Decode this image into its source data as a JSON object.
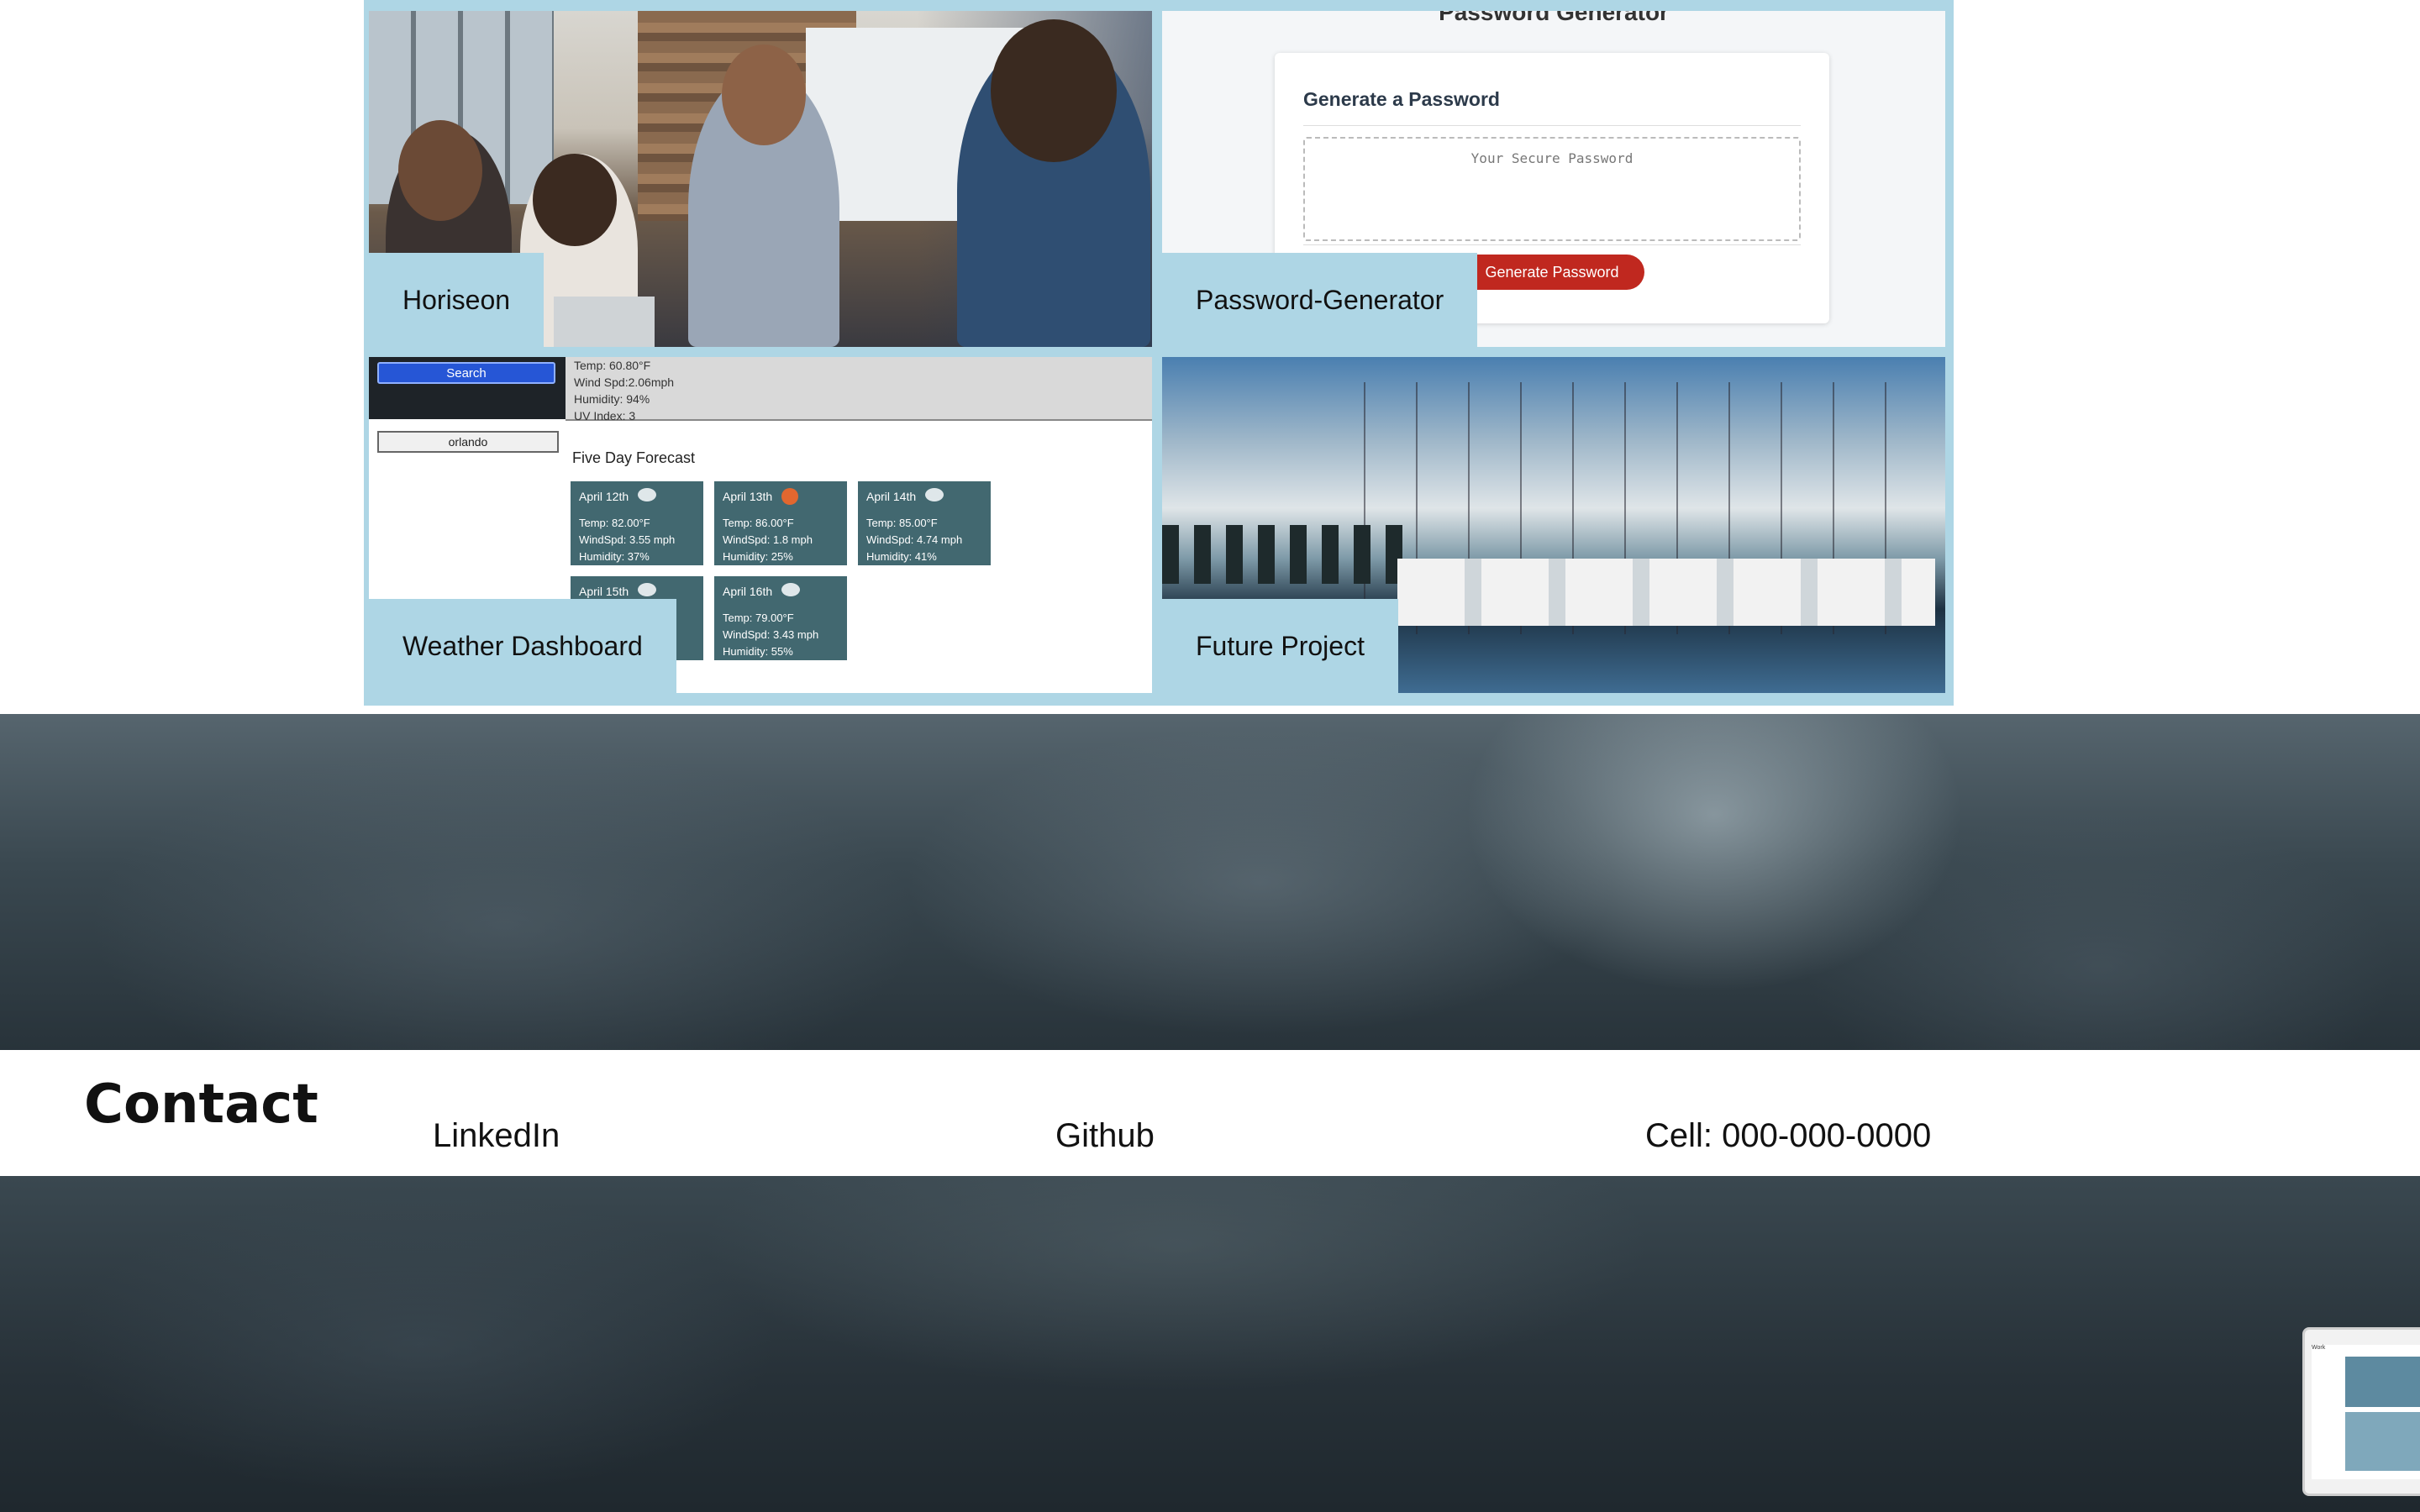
{
  "projects": [
    {
      "label": "Horiseon",
      "image": "office-team-photo"
    },
    {
      "label": "Password-Generator",
      "image": "password-generator-screenshot"
    },
    {
      "label": "Weather Dashboard",
      "image": "weather-dashboard-screenshot"
    },
    {
      "label": "Future Project",
      "image": "marina-photo"
    }
  ],
  "password_app": {
    "title": "Password Generator",
    "card_heading": "Generate a Password",
    "placeholder": "Your Secure Password",
    "button": "Generate Password"
  },
  "weather_app": {
    "search_button": "Search",
    "city": "orlando",
    "current": [
      "Temp: 60.80°F",
      "Wind Spd:2.06mph",
      "Humidity: 94%",
      "UV Index: 3"
    ],
    "forecast_heading": "Five Day Forecast",
    "forecast": [
      {
        "date": "April 12th",
        "icon": "cloud-icon",
        "temp": "Temp: 82.00°F",
        "wind": "WindSpd: 3.55 mph",
        "humidity": "Humidity: 37%"
      },
      {
        "date": "April 13th",
        "icon": "sun-icon",
        "temp": "Temp: 86.00°F",
        "wind": "WindSpd: 1.8 mph",
        "humidity": "Humidity: 25%"
      },
      {
        "date": "April 14th",
        "icon": "cloud-icon",
        "temp": "Temp: 85.00°F",
        "wind": "WindSpd: 4.74 mph",
        "humidity": "Humidity: 41%"
      },
      {
        "date": "April 15th",
        "icon": "cloud-icon",
        "temp": "",
        "wind": "",
        "humidity": ""
      },
      {
        "date": "April 16th",
        "icon": "cloud-icon",
        "temp": "Temp: 79.00°F",
        "wind": "WindSpd: 3.43 mph",
        "humidity": "Humidity: 55%"
      }
    ]
  },
  "contact": {
    "title": "Contact",
    "links": [
      {
        "label": "LinkedIn"
      },
      {
        "label": "Github"
      },
      {
        "label": "Cell: 000-000-0000"
      }
    ]
  },
  "thumbnail": {
    "title": "Work"
  },
  "colors": {
    "label_bg": "#aed6e5",
    "page_bg": "#ffffff",
    "storm_dark": "#28333a",
    "button_red": "#c0281f",
    "weather_card": "#426870"
  }
}
